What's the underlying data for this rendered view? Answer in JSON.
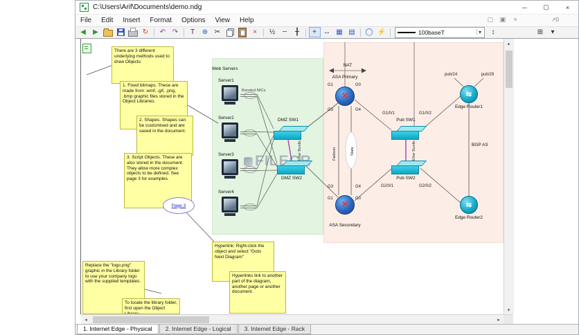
{
  "window": {
    "title": "C:\\Users\\Arif\\Documents\\demo.ndg"
  },
  "menu": {
    "items": [
      "File",
      "Edit",
      "Insert",
      "Format",
      "Options",
      "View",
      "Help"
    ]
  },
  "toolbar": {
    "line_style": "100baseT"
  },
  "icons": {
    "back": "◀",
    "forward": "▶",
    "refresh": "↻",
    "undo": "↶",
    "redo": "↷",
    "text_tool": "T",
    "globe": "⊕",
    "cut": "✂",
    "delete": "×",
    "half": "½",
    "dashes": "╌",
    "ruler": "╂",
    "crosshair": "+",
    "move": "↔",
    "grid": "▦",
    "grid2": "▤",
    "circle": "◯",
    "bolt": "⚡",
    "connector": "↕",
    "layout": "⊞",
    "caret": "▾",
    "mdi_tile": "▢",
    "mdi_cascade": "▣",
    "mdi_close": "×",
    "nav": "↗0",
    "scroll_up": "▴",
    "scroll_down": "▾",
    "scroll_left": "◂",
    "scroll_right": "▸",
    "minimize": "─",
    "maximize": "▢",
    "close": "×"
  },
  "tabs": {
    "t1": "1. Internet Edge - Physical",
    "t2": "2. Internet Edge - Logical",
    "t3": "3. Internet Edge - Rack"
  },
  "notes": {
    "methods": "There are 3 different underlying methods used to draw Objects:",
    "bitmaps": "1. Fixed bitmaps. These are made from .wmf, .gif, .png, .bmp graphic files stored in the Object Libraries.",
    "shapes": "2. Shapes. Shapes can be customised and are saved in the document.",
    "scripts": "3. Script Objects. These are also stored in the document. They allow more complex objects to be defined. See page 3 for examples.",
    "hyperlink": "Hyperlink: Right-click the object and select \"Goto Next Diagram\"",
    "hyperlinks_link": "Hyperlinks link to another part of the diagram, another page or another document.",
    "logo": "Replace the \"logo.png\" graphic in the Library folder to use your company logo with the supplied templates.",
    "library": "To locate the library folder, first open the Object Library"
  },
  "diagram": {
    "watermark": "FILECR",
    "page_link": "Page 3",
    "labels": {
      "web_servers": "Web Servers",
      "bonded_nics": "Bonded NICs",
      "nat": "NAT",
      "bgp_as": "BGP AS",
      "failover": "Failover",
      "state": "State",
      "ether_bundle": "Ether Bundle"
    },
    "nodes": {
      "server1": "Server1",
      "server2": "Server2",
      "server3": "Server3",
      "server4": "Server4",
      "dmz_sw1": "DMZ SW1",
      "dmz_sw2": "DMZ SW2",
      "pub_sw1": "Pub SW1",
      "pub_sw2": "Pub SW2",
      "asa_primary": "ASA Primary",
      "asa_secondary": "ASA Secondary",
      "edge_router1": "Edge Router1",
      "edge_router2": "Edge Router2"
    },
    "ports": {
      "g0": "G0",
      "g1": "G1",
      "g3": "G3",
      "g4": "G4",
      "g101": "G1/0/1",
      "g102": "G1/0/2",
      "g201": "G2/0/1",
      "g202": "G2/0/2",
      "pub24": "pub/24",
      "pub29": "pub/29"
    }
  },
  "colors": {
    "zone_green": "#e3f4e1",
    "zone_pink": "#fceee7",
    "note_yellow": "#ffffa3",
    "cisco_cyan": "#0fa6c6",
    "asa_blue": "#2a66c0",
    "bundle_purple": "#b23ab2"
  }
}
